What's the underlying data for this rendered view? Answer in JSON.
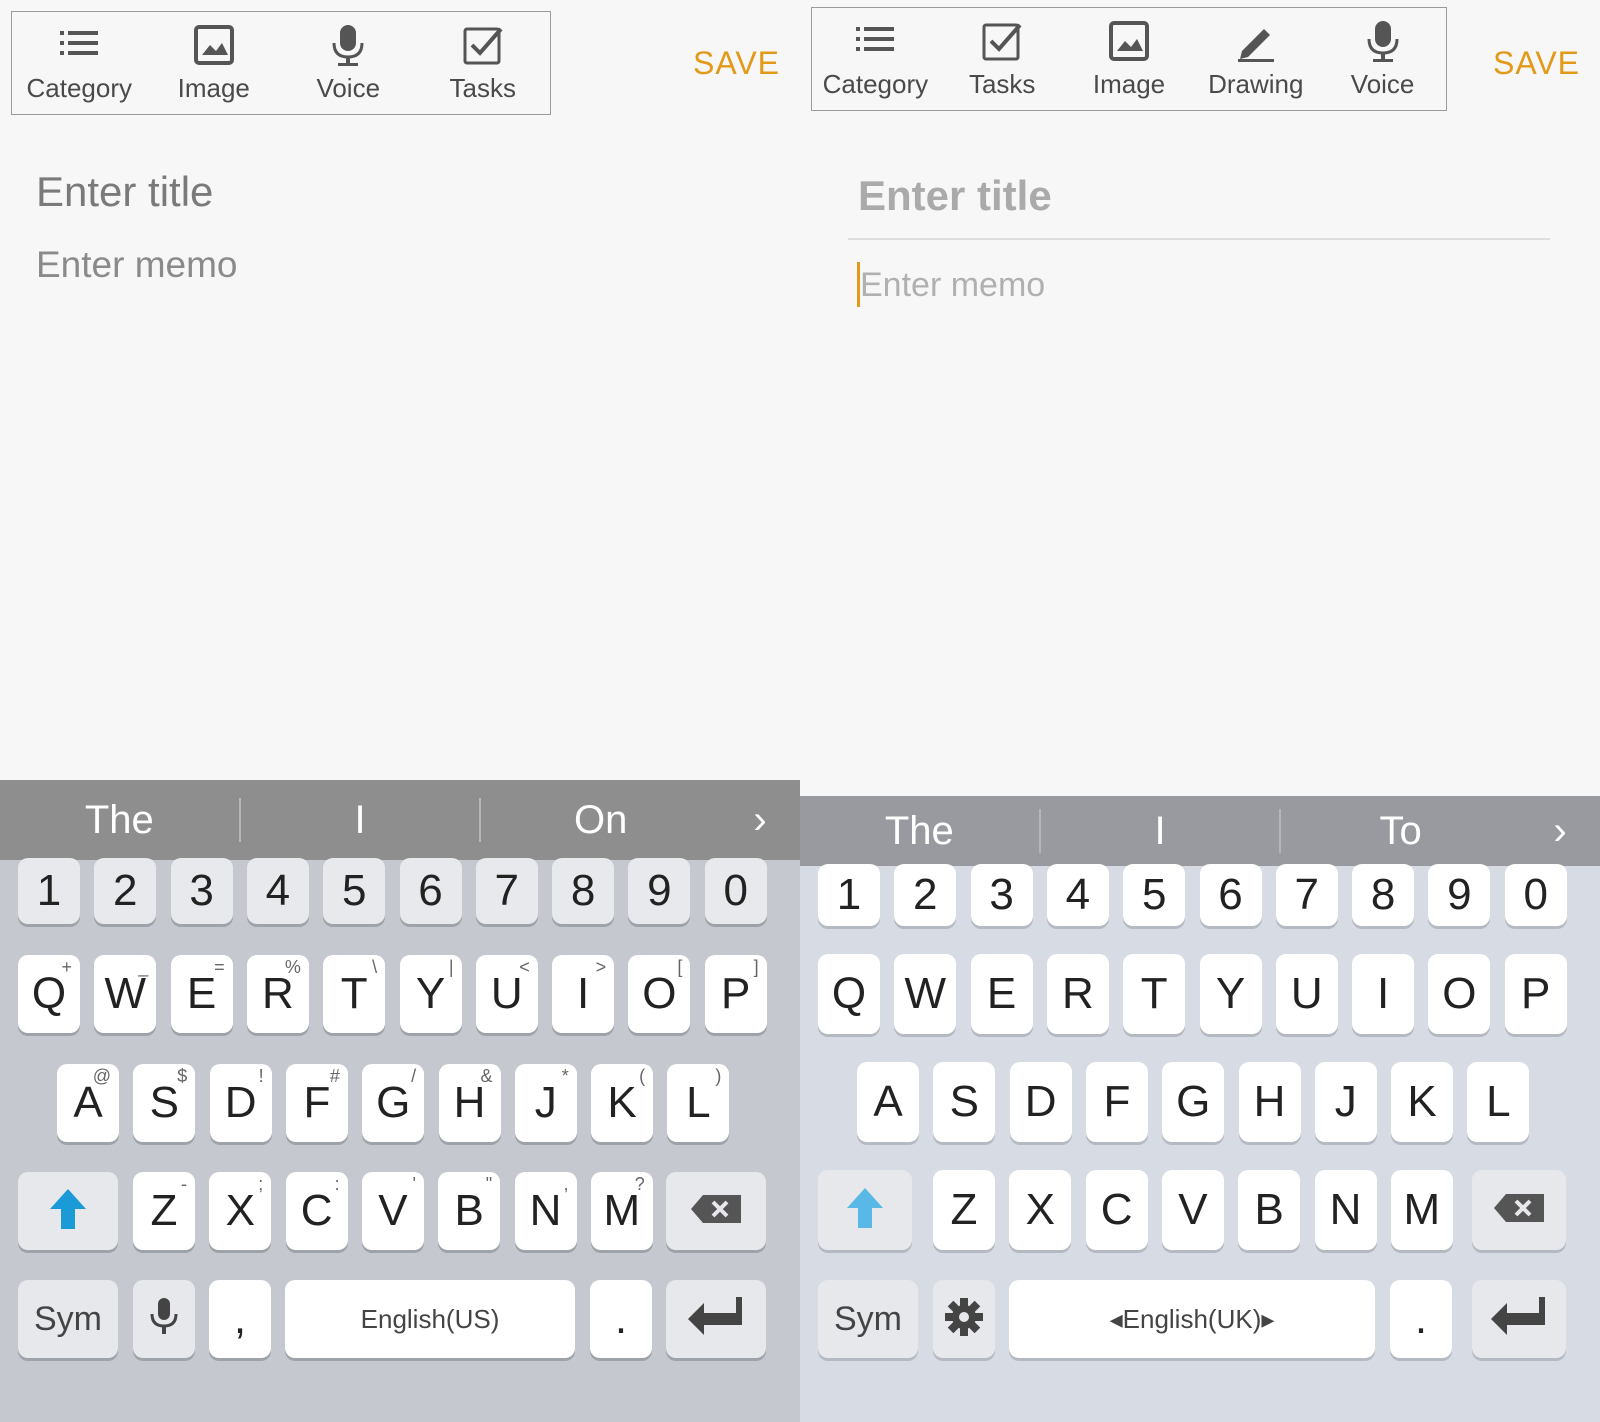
{
  "left": {
    "toolbar": [
      {
        "icon": "list-icon",
        "label": "Category"
      },
      {
        "icon": "image-icon",
        "label": "Image"
      },
      {
        "icon": "microphone-icon",
        "label": "Voice"
      },
      {
        "icon": "checkbox-icon",
        "label": "Tasks"
      }
    ],
    "save": "SAVE",
    "title_placeholder": "Enter title",
    "memo_placeholder": "Enter memo",
    "suggestions": [
      "The",
      "I",
      "On"
    ],
    "numbers": [
      "1",
      "2",
      "3",
      "4",
      "5",
      "6",
      "7",
      "8",
      "9",
      "0"
    ],
    "row1": [
      {
        "k": "Q",
        "s": "+"
      },
      {
        "k": "W",
        "s": "_"
      },
      {
        "k": "E",
        "s": "="
      },
      {
        "k": "R",
        "s": "%"
      },
      {
        "k": "T",
        "s": "\\"
      },
      {
        "k": "Y",
        "s": "|"
      },
      {
        "k": "U",
        "s": "<"
      },
      {
        "k": "I",
        "s": ">"
      },
      {
        "k": "O",
        "s": "["
      },
      {
        "k": "P",
        "s": "]"
      }
    ],
    "row2": [
      {
        "k": "A",
        "s": "@"
      },
      {
        "k": "S",
        "s": "$"
      },
      {
        "k": "D",
        "s": "!"
      },
      {
        "k": "F",
        "s": "#"
      },
      {
        "k": "G",
        "s": "/"
      },
      {
        "k": "H",
        "s": "&"
      },
      {
        "k": "J",
        "s": "*"
      },
      {
        "k": "K",
        "s": "("
      },
      {
        "k": "L",
        "s": ")"
      }
    ],
    "row3": [
      {
        "k": "Z",
        "s": "-"
      },
      {
        "k": "X",
        "s": ";"
      },
      {
        "k": "C",
        "s": ":"
      },
      {
        "k": "V",
        "s": "'"
      },
      {
        "k": "B",
        "s": "\""
      },
      {
        "k": "N",
        "s": ","
      },
      {
        "k": "M",
        "s": "?"
      }
    ],
    "sym": "Sym",
    "comma": ",",
    "space": "English(US)",
    "period": "."
  },
  "right": {
    "toolbar": [
      {
        "icon": "list-icon",
        "label": "Category"
      },
      {
        "icon": "checkbox-icon",
        "label": "Tasks"
      },
      {
        "icon": "image-icon",
        "label": "Image"
      },
      {
        "icon": "pencil-icon",
        "label": "Drawing"
      },
      {
        "icon": "microphone-icon",
        "label": "Voice"
      }
    ],
    "save": "SAVE",
    "title_placeholder": "Enter title",
    "memo_placeholder": "Enter memo",
    "suggestions": [
      "The",
      "I",
      "To"
    ],
    "numbers": [
      "1",
      "2",
      "3",
      "4",
      "5",
      "6",
      "7",
      "8",
      "9",
      "0"
    ],
    "row1": [
      "Q",
      "W",
      "E",
      "R",
      "T",
      "Y",
      "U",
      "I",
      "O",
      "P"
    ],
    "row2": [
      "A",
      "S",
      "D",
      "F",
      "G",
      "H",
      "J",
      "K",
      "L"
    ],
    "row3": [
      "Z",
      "X",
      "C",
      "V",
      "B",
      "N",
      "M"
    ],
    "sym": "Sym",
    "space": "English(UK)",
    "period": "."
  },
  "colors": {
    "accent": "#e39a19",
    "shift_blue": "#1a9bd7",
    "shift_blue_light": "#5ab8e6"
  }
}
